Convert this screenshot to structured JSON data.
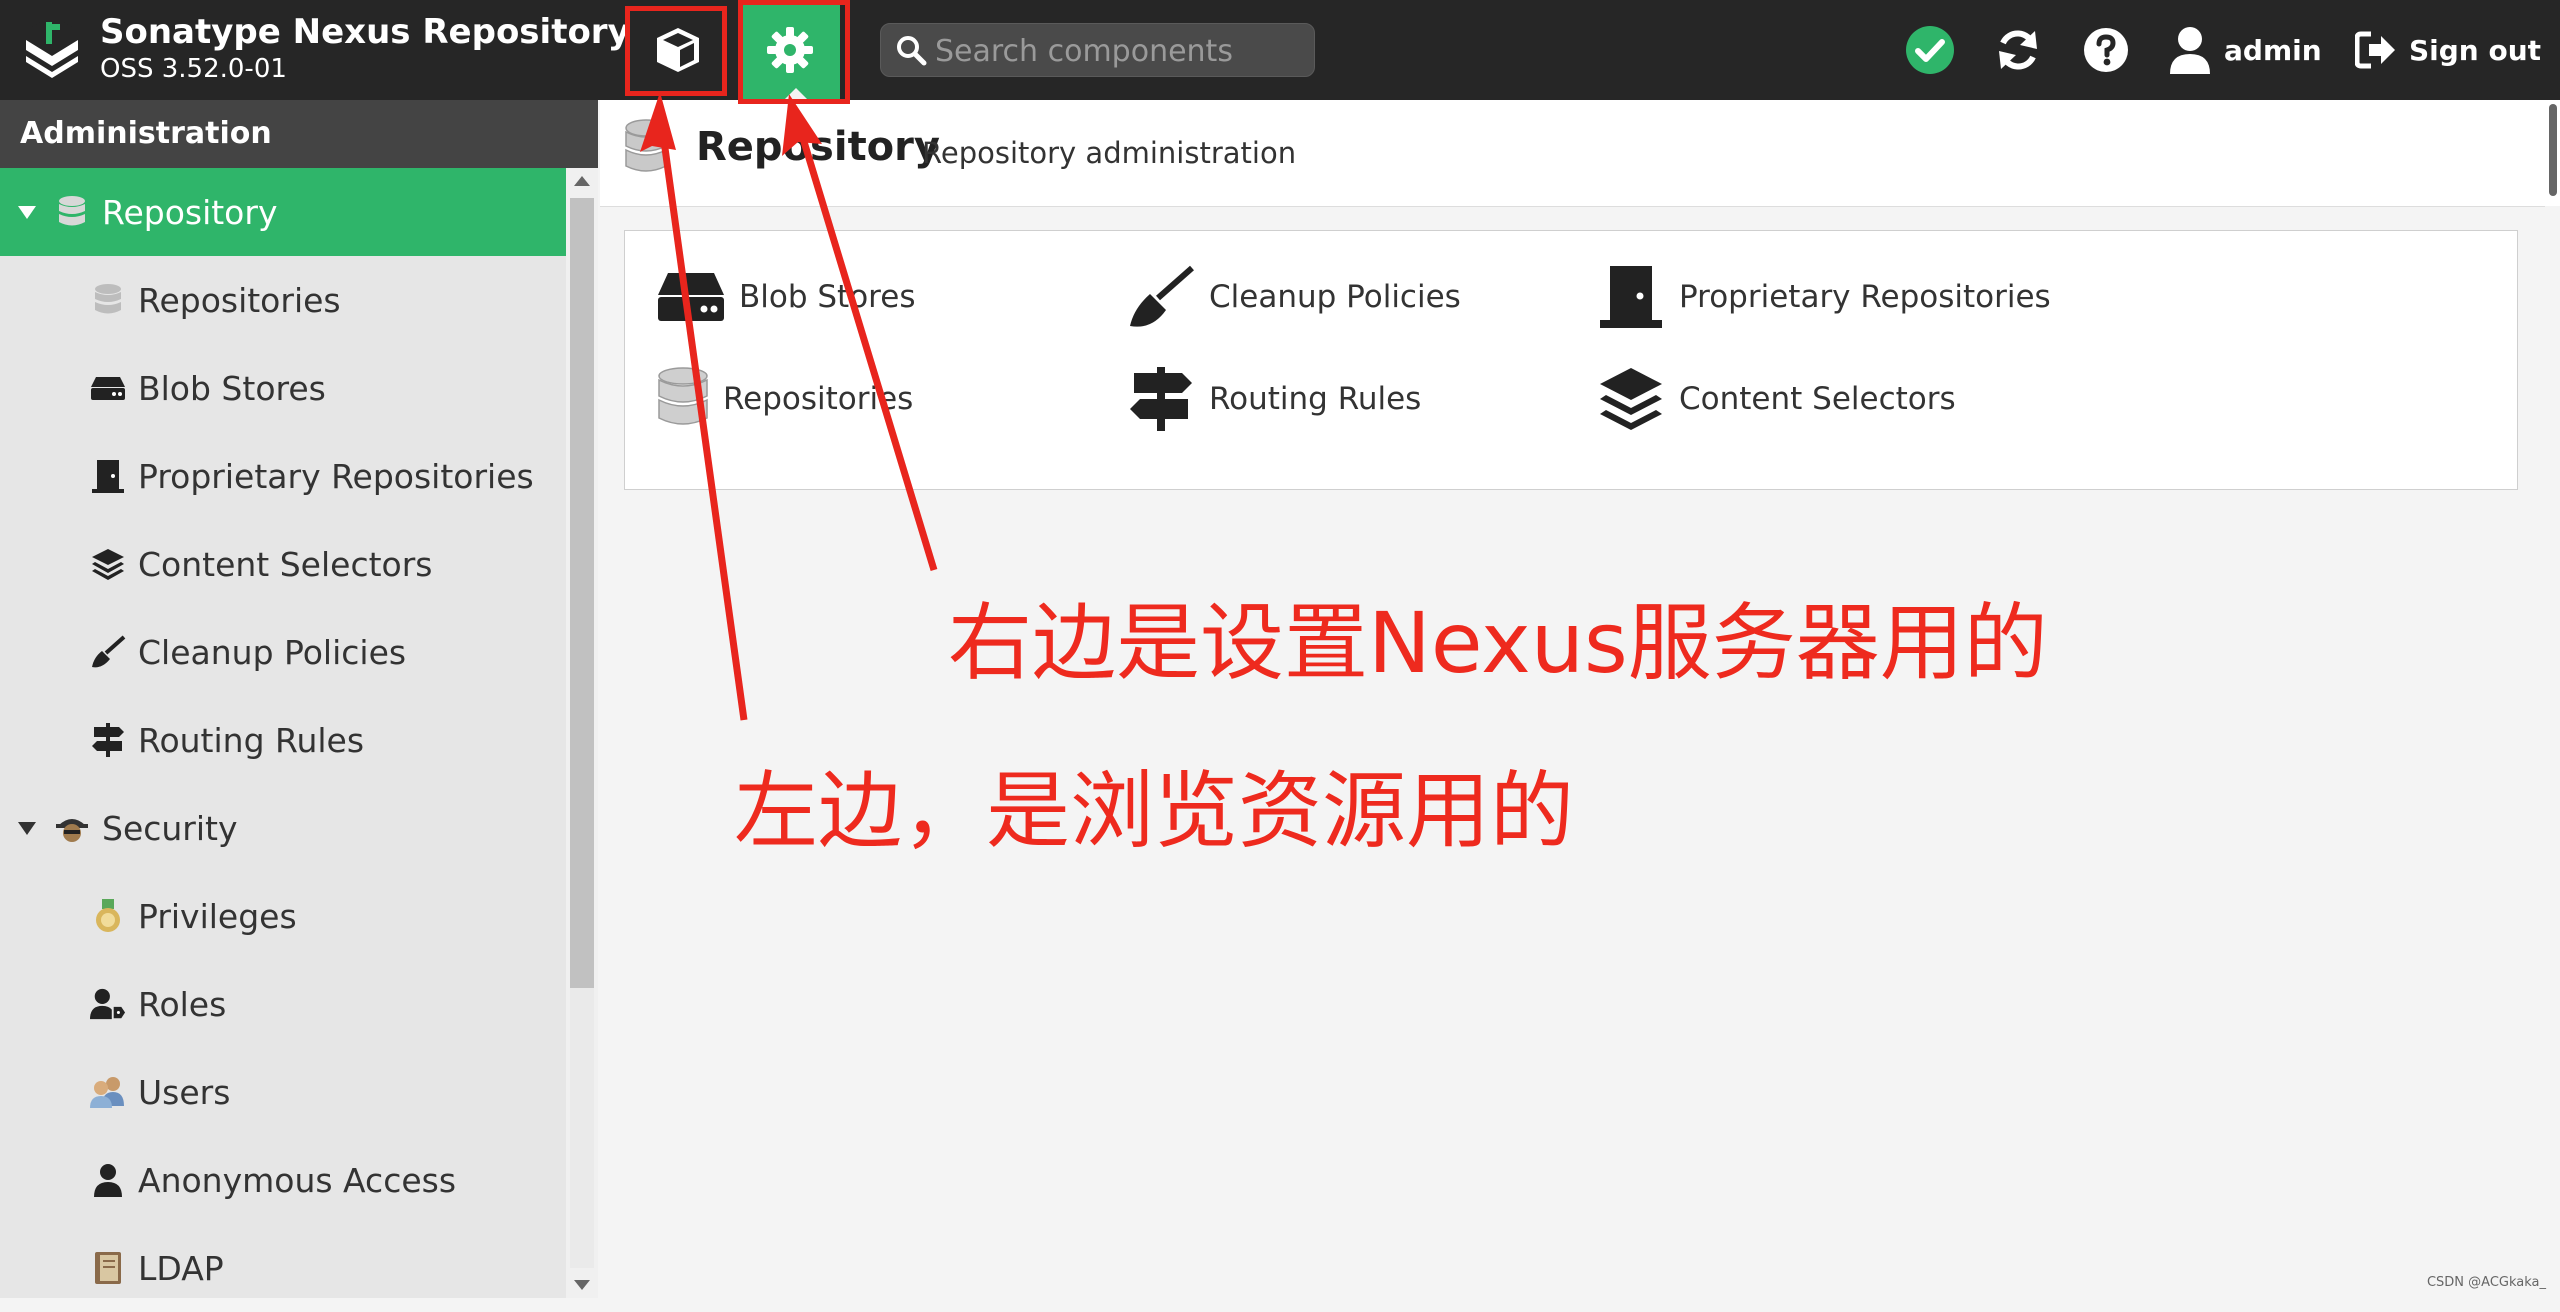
{
  "header": {
    "app_title": "Sonatype Nexus Repository",
    "version": "OSS 3.52.0-01",
    "search_placeholder": "Search components",
    "username": "admin",
    "signout_label": "Sign out"
  },
  "sidebar": {
    "title": "Administration",
    "items": [
      {
        "label": "Repository",
        "icon": "database-icon",
        "level": 0,
        "expanded": true,
        "selected": true
      },
      {
        "label": "Repositories",
        "icon": "database-icon",
        "level": 1
      },
      {
        "label": "Blob Stores",
        "icon": "hard-drive-icon",
        "level": 1
      },
      {
        "label": "Proprietary Repositories",
        "icon": "door-icon",
        "level": 1
      },
      {
        "label": "Content Selectors",
        "icon": "layers-icon",
        "level": 1
      },
      {
        "label": "Cleanup Policies",
        "icon": "broom-icon",
        "level": 1
      },
      {
        "label": "Routing Rules",
        "icon": "signpost-icon",
        "level": 1
      },
      {
        "label": "Security",
        "icon": "spy-icon",
        "level": 0,
        "expanded": true
      },
      {
        "label": "Privileges",
        "icon": "medal-icon",
        "level": 1
      },
      {
        "label": "Roles",
        "icon": "user-tag-icon",
        "level": 1
      },
      {
        "label": "Users",
        "icon": "users-icon",
        "level": 1
      },
      {
        "label": "Anonymous Access",
        "icon": "user-icon",
        "level": 1
      },
      {
        "label": "LDAP",
        "icon": "book-icon",
        "level": 1
      }
    ]
  },
  "page": {
    "title": "Repository",
    "subtitle": "Repository administration"
  },
  "features": [
    {
      "label": "Blob Stores",
      "icon": "hard-drive-icon"
    },
    {
      "label": "Cleanup Policies",
      "icon": "broom-icon"
    },
    {
      "label": "Proprietary Repositories",
      "icon": "door-icon"
    },
    {
      "label": "Repositories",
      "icon": "database-icon"
    },
    {
      "label": "Routing Rules",
      "icon": "signpost-icon"
    },
    {
      "label": "Content Selectors",
      "icon": "layers-icon"
    }
  ],
  "annotations": {
    "right_note": "右边是设置Nexus服务器用的",
    "left_note": "左边，是浏览资源用的"
  },
  "watermark": "CSDN @ACGkaka_",
  "colors": {
    "topbar": "#262626",
    "accent_green": "#2fb56a",
    "annotation_red": "#e8251d",
    "status_ok": "#2fb56a"
  }
}
